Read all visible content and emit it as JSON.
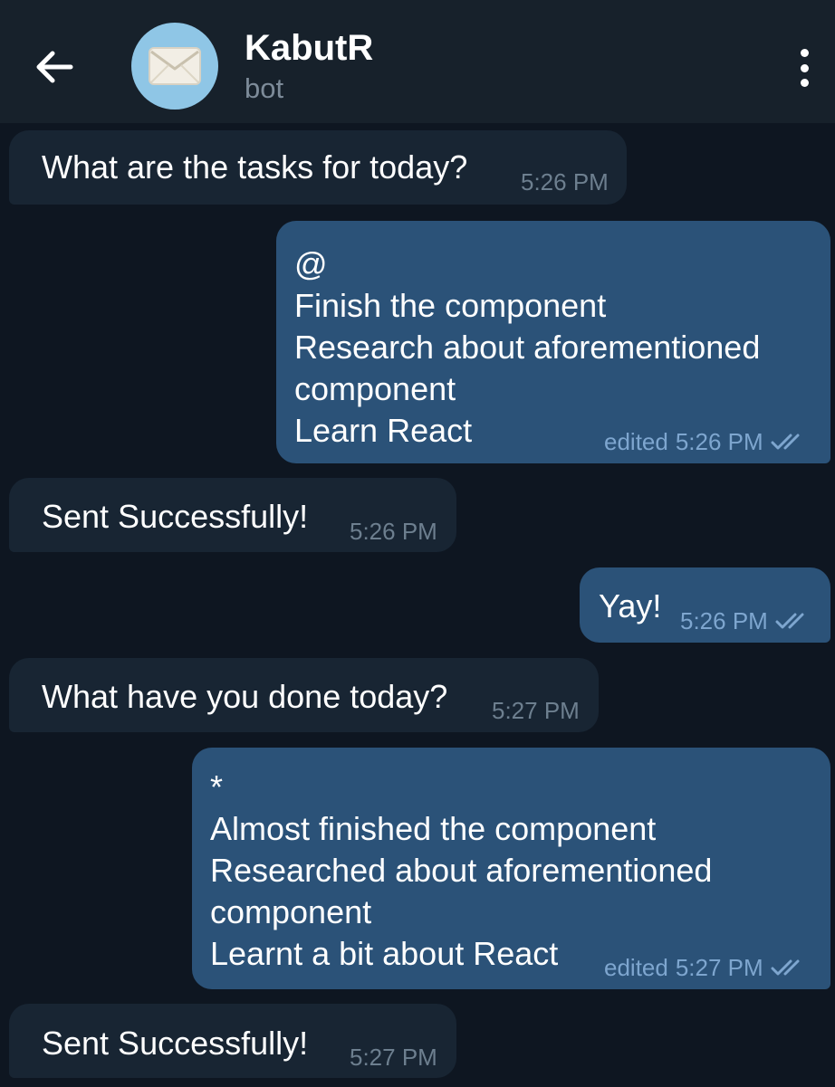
{
  "header": {
    "title": "KabutR",
    "subtitle": "bot"
  },
  "messages": [
    {
      "dir": "in",
      "text": "What are the tasks for today?",
      "time": "5:26 PM"
    },
    {
      "dir": "out",
      "text": "@\nFinish the component\nResearch about aforementioned\ncomponent\nLearn React",
      "edited": "edited",
      "time": "5:26 PM"
    },
    {
      "dir": "in",
      "text": "Sent Successfully!",
      "time": "5:26 PM"
    },
    {
      "dir": "out",
      "text": "Yay!",
      "time": "5:26 PM"
    },
    {
      "dir": "in",
      "text": "What have you done today?",
      "time": "5:27 PM"
    },
    {
      "dir": "out",
      "text": "*\nAlmost finished the component\nResearched about aforementioned\ncomponent\nLearnt a bit about React",
      "edited": "edited",
      "time": "5:27 PM"
    },
    {
      "dir": "in",
      "text": "Sent Successfully!",
      "time": "5:27 PM"
    }
  ],
  "colors": {
    "background": "#0e1621",
    "header": "#17212b",
    "incoming_bubble": "#182533",
    "outgoing_bubble": "#2b5278",
    "avatar": "#8fc6e6",
    "meta_text": "#7ea6cf"
  },
  "icons": {
    "back": "arrow-left-icon",
    "avatar": "envelope-icon",
    "menu": "vertical-dots-icon",
    "read_status": "double-check-icon"
  }
}
